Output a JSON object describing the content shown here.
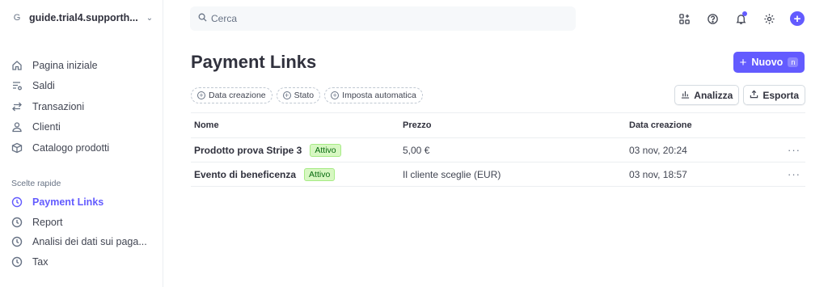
{
  "account": {
    "initial": "G",
    "name": "guide.trial4.supporth..."
  },
  "nav": [
    {
      "label": "Pagina iniziale",
      "icon": "home-icon"
    },
    {
      "label": "Saldi",
      "icon": "balance-icon"
    },
    {
      "label": "Transazioni",
      "icon": "transactions-icon"
    },
    {
      "label": "Clienti",
      "icon": "customers-icon"
    },
    {
      "label": "Catalogo prodotti",
      "icon": "product-catalog-icon"
    }
  ],
  "shortcuts": {
    "title": "Scelte rapide",
    "items": [
      {
        "label": "Payment Links",
        "active": true
      },
      {
        "label": "Report",
        "active": false
      },
      {
        "label": "Analisi dei dati sui paga...",
        "active": false
      },
      {
        "label": "Tax",
        "active": false
      }
    ]
  },
  "search": {
    "placeholder": "Cerca"
  },
  "colors": {
    "accent": "#635bff",
    "badge_bg": "#d7f7c2",
    "badge_text": "#05690d"
  },
  "page": {
    "title": "Payment Links",
    "new_button": {
      "label": "Nuovo",
      "shortcut": "n"
    }
  },
  "filters": [
    "Data creazione",
    "Stato",
    "Imposta automatica"
  ],
  "actions": {
    "analyze": "Analizza",
    "export": "Esporta"
  },
  "table": {
    "columns": [
      "Nome",
      "Prezzo",
      "Data creazione"
    ],
    "rows": [
      {
        "name": "Prodotto prova Stripe 3",
        "status": "Attivo",
        "price": "5,00 €",
        "date": "03 nov, 20:24",
        "more": "···"
      },
      {
        "name": "Evento di beneficenza",
        "status": "Attivo",
        "price": "Il cliente sceglie (EUR)",
        "date": "03 nov, 18:57",
        "more": "···"
      }
    ]
  }
}
